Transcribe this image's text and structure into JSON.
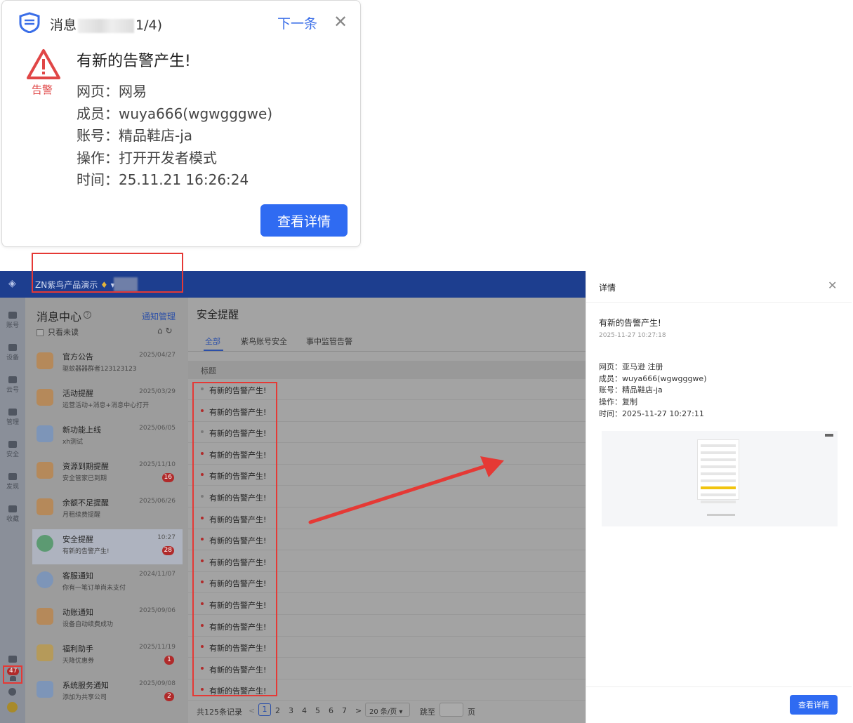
{
  "popup": {
    "title_prefix": "消息",
    "title_suffix": "1/4)",
    "next_label": "下一条",
    "close_glyph": "✕",
    "alert_label": "告警",
    "headline": "有新的告警产生!",
    "lines": [
      "网页：网易",
      "成员：wuya666(wgwgggwe)",
      "账号：精品鞋店-ja",
      "操作：打开开发者模式",
      "时间：25.11.21 16:26:24"
    ],
    "button_label": "查看详情",
    "accent_color": "#2f6bf2",
    "alert_color": "#e04646"
  },
  "app": {
    "org_name": "ZN紫鸟产品演示",
    "nav": [
      {
        "label": "账号"
      },
      {
        "label": "设备"
      },
      {
        "label": "云号"
      },
      {
        "label": "管理"
      },
      {
        "label": "安全"
      },
      {
        "label": "发现"
      },
      {
        "label": "收藏"
      }
    ],
    "nav_badge": "47",
    "message_center": {
      "title": "消息中心",
      "manage_label": "通知管理",
      "unread_only_label": "只看未读",
      "items": [
        {
          "title": "官方公告",
          "date": "2025/04/27",
          "sub": "驱蚊器器群者123123123",
          "badge": "",
          "color": "#d9842f"
        },
        {
          "title": "活动提醒",
          "date": "2025/03/29",
          "sub": "运营活动+消息+消息中心打开",
          "badge": "",
          "color": "#d9842f"
        },
        {
          "title": "新功能上线",
          "date": "2025/06/05",
          "sub": "xh测试",
          "badge": "",
          "color": "#5b8fd6"
        },
        {
          "title": "资源到期提醒",
          "date": "2025/11/10",
          "sub": "安全管家已到期",
          "badge": "16",
          "color": "#d9842f"
        },
        {
          "title": "余额不足提醒",
          "date": "2025/06/26",
          "sub": "月租续费提醒",
          "badge": "",
          "color": "#d9842f"
        },
        {
          "title": "安全提醒",
          "date": "10:27",
          "sub": "有新的告警产生!",
          "badge": "28",
          "color": "#3aa863"
        },
        {
          "title": "客服通知",
          "date": "2024/11/07",
          "sub": "你有一笔订单尚未支付",
          "badge": "",
          "color": "#5b8fd6"
        },
        {
          "title": "动账通知",
          "date": "2025/09/06",
          "sub": "设备自动续费成功",
          "badge": "",
          "color": "#d9842f"
        },
        {
          "title": "福利助手",
          "date": "2025/11/19",
          "sub": "天降优惠券",
          "badge": "1",
          "color": "#d9a52f"
        },
        {
          "title": "系统服务通知",
          "date": "2025/09/08",
          "sub": "添加为共享公司",
          "badge": "2",
          "color": "#5b8fd6"
        }
      ]
    },
    "content": {
      "title": "安全提醒",
      "tabs": [
        "全部",
        "紫鸟账号安全",
        "事中监管告警"
      ],
      "column_header": "标题",
      "row_text": "有新的告警产生!",
      "rows_read": [
        true,
        false,
        true,
        false,
        false,
        true,
        false,
        false,
        false,
        false,
        false,
        false,
        false,
        false,
        false
      ],
      "pager": {
        "total": "共125条记录",
        "pages": [
          "1",
          "2",
          "3",
          "4",
          "5",
          "6",
          "7"
        ],
        "prev": "<",
        "next": ">",
        "size": "20 条/页",
        "jump": "跳至",
        "page_suffix": "页"
      }
    }
  },
  "drawer": {
    "title": "详情",
    "close_glyph": "✕",
    "headline": "有新的告警产生!",
    "time": "2025-11-27 10:27:18",
    "lines": [
      "网页：亚马逊 注册",
      "成员：wuya666(wgwgggwe)",
      "账号：精品鞋店-ja",
      "操作：复制",
      "时间：2025-11-27 10:27:11"
    ],
    "button_label": "查看详情"
  }
}
